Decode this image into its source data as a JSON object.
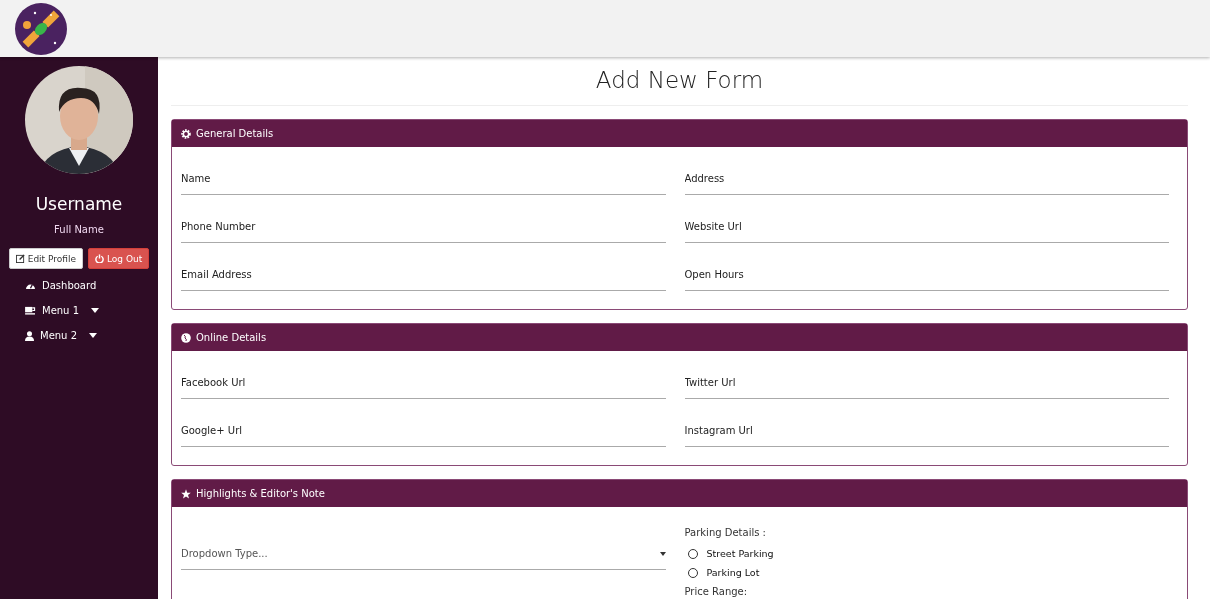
{
  "sidebar": {
    "username": "Username",
    "full_name": "Full Name",
    "buttons": [
      {
        "kind": "edit",
        "label": "Edit Profile"
      },
      {
        "kind": "logout",
        "label": "Log Out"
      }
    ],
    "menu": [
      {
        "label": "Dashboard",
        "has_caret": false
      },
      {
        "label": "Menu 1",
        "has_caret": true
      },
      {
        "label": "Menu 2",
        "has_caret": true
      }
    ]
  },
  "page_title": "Add New Form",
  "panels": [
    {
      "title": "General Details",
      "fields": [
        {
          "placeholder": "Name"
        },
        {
          "placeholder": "Address"
        },
        {
          "placeholder": "Phone Number"
        },
        {
          "placeholder": "Website Url"
        },
        {
          "placeholder": "Email Address"
        },
        {
          "placeholder": "Open Hours"
        }
      ]
    },
    {
      "title": "Online Details",
      "fields": [
        {
          "placeholder": "Facebook Url"
        },
        {
          "placeholder": "Twitter Url"
        },
        {
          "placeholder": "Google+ Url"
        },
        {
          "placeholder": "Instagram Url"
        }
      ]
    },
    {
      "title": "Highlights & Editor's Note",
      "dropdown": {
        "placeholder": "Dropdown Type..."
      },
      "parking": {
        "label": "Parking Details :",
        "options": [
          {
            "label": "Street Parking",
            "selected": false
          },
          {
            "label": "Parking Lot",
            "selected": false
          }
        ]
      },
      "price_label": "Price Range:"
    }
  ]
}
